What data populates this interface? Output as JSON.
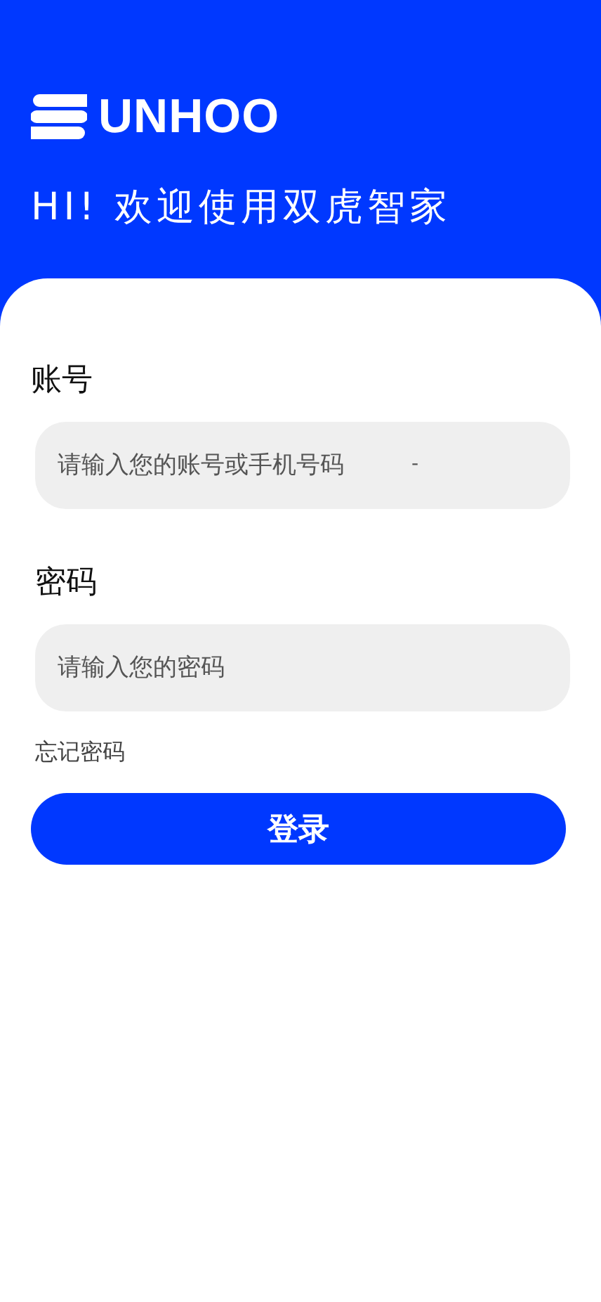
{
  "header": {
    "logo": "UNHOO",
    "greeting": "HI! 欢迎使用双虎智家"
  },
  "fields": [
    {
      "label": "账号",
      "placeholder": "请输入您的账号或手机号码",
      "suffix": "-"
    },
    {
      "label": "密码",
      "placeholder": "请输入您的密码"
    }
  ],
  "forgot_link": "忘记密码",
  "login_button": "登录"
}
